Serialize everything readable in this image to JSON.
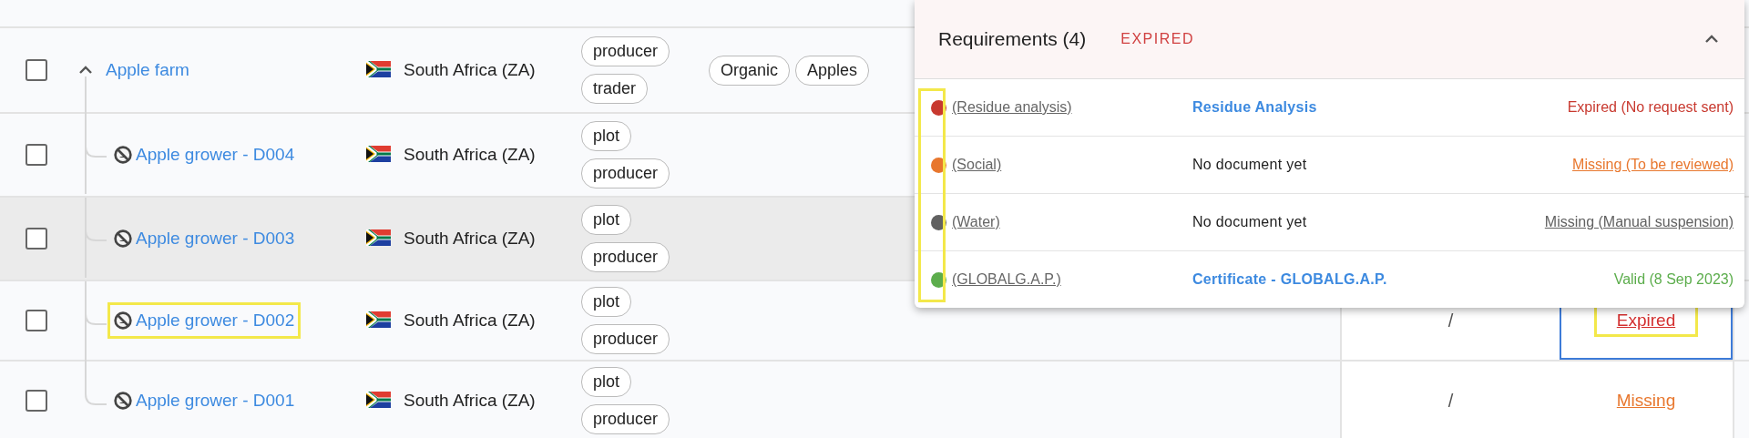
{
  "rows": [
    {
      "kind": "parent",
      "name": "Apple farm",
      "expanded": true,
      "checked": false,
      "hovered": false,
      "highlighted": false,
      "country": "South Africa (ZA)",
      "roles": [
        "producer",
        "trader"
      ],
      "tags": [
        "Organic",
        "Apples"
      ]
    },
    {
      "kind": "child",
      "name": "Apple grower - D004",
      "checked": false,
      "hovered": false,
      "highlighted": false,
      "country": "South Africa (ZA)",
      "roles": [
        "plot",
        "producer"
      ]
    },
    {
      "kind": "child",
      "name": "Apple grower - D003",
      "checked": false,
      "hovered": true,
      "highlighted": false,
      "country": "South Africa (ZA)",
      "roles": [
        "plot",
        "producer"
      ]
    },
    {
      "kind": "child",
      "name": "Apple grower - D002",
      "checked": false,
      "hovered": false,
      "highlighted": true,
      "country": "South Africa (ZA)",
      "roles": [
        "plot",
        "producer"
      ],
      "value": "/",
      "status": {
        "text": "Expired",
        "color": "#d32f2f",
        "selected": true,
        "highlighted": true
      }
    },
    {
      "kind": "child",
      "name": "Apple grower - D001",
      "checked": false,
      "hovered": false,
      "highlighted": false,
      "country": "South Africa (ZA)",
      "roles": [
        "plot",
        "producer"
      ],
      "value": "/",
      "status": {
        "text": "Missing",
        "color": "#e8772e",
        "selected": false,
        "highlighted": false
      }
    }
  ],
  "popup": {
    "title": "Requirements (4)",
    "status": "EXPIRED",
    "expanded": true,
    "dots_highlighted": true,
    "items": [
      {
        "color": "#c8392f",
        "name": "(Residue analysis)",
        "document": {
          "kind": "link",
          "text": "Residue Analysis"
        },
        "status": "Expired (No request sent)",
        "underlined": false
      },
      {
        "color": "#e8772e",
        "name": "(Social)",
        "document": {
          "kind": "text",
          "text": "No document yet"
        },
        "status": "Missing (To be reviewed)",
        "underlined": true
      },
      {
        "color": "#616161",
        "name": "(Water)",
        "document": {
          "kind": "text",
          "text": "No document yet"
        },
        "status": "Missing (Manual suspension)",
        "underlined": true
      },
      {
        "color": "#5cad4c",
        "name": "(GLOBALG.A.P.)",
        "document": {
          "kind": "link",
          "text": "Certificate - GLOBALG.A.P."
        },
        "status": "Valid (8 Sep 2023)",
        "underlined": false
      }
    ]
  }
}
